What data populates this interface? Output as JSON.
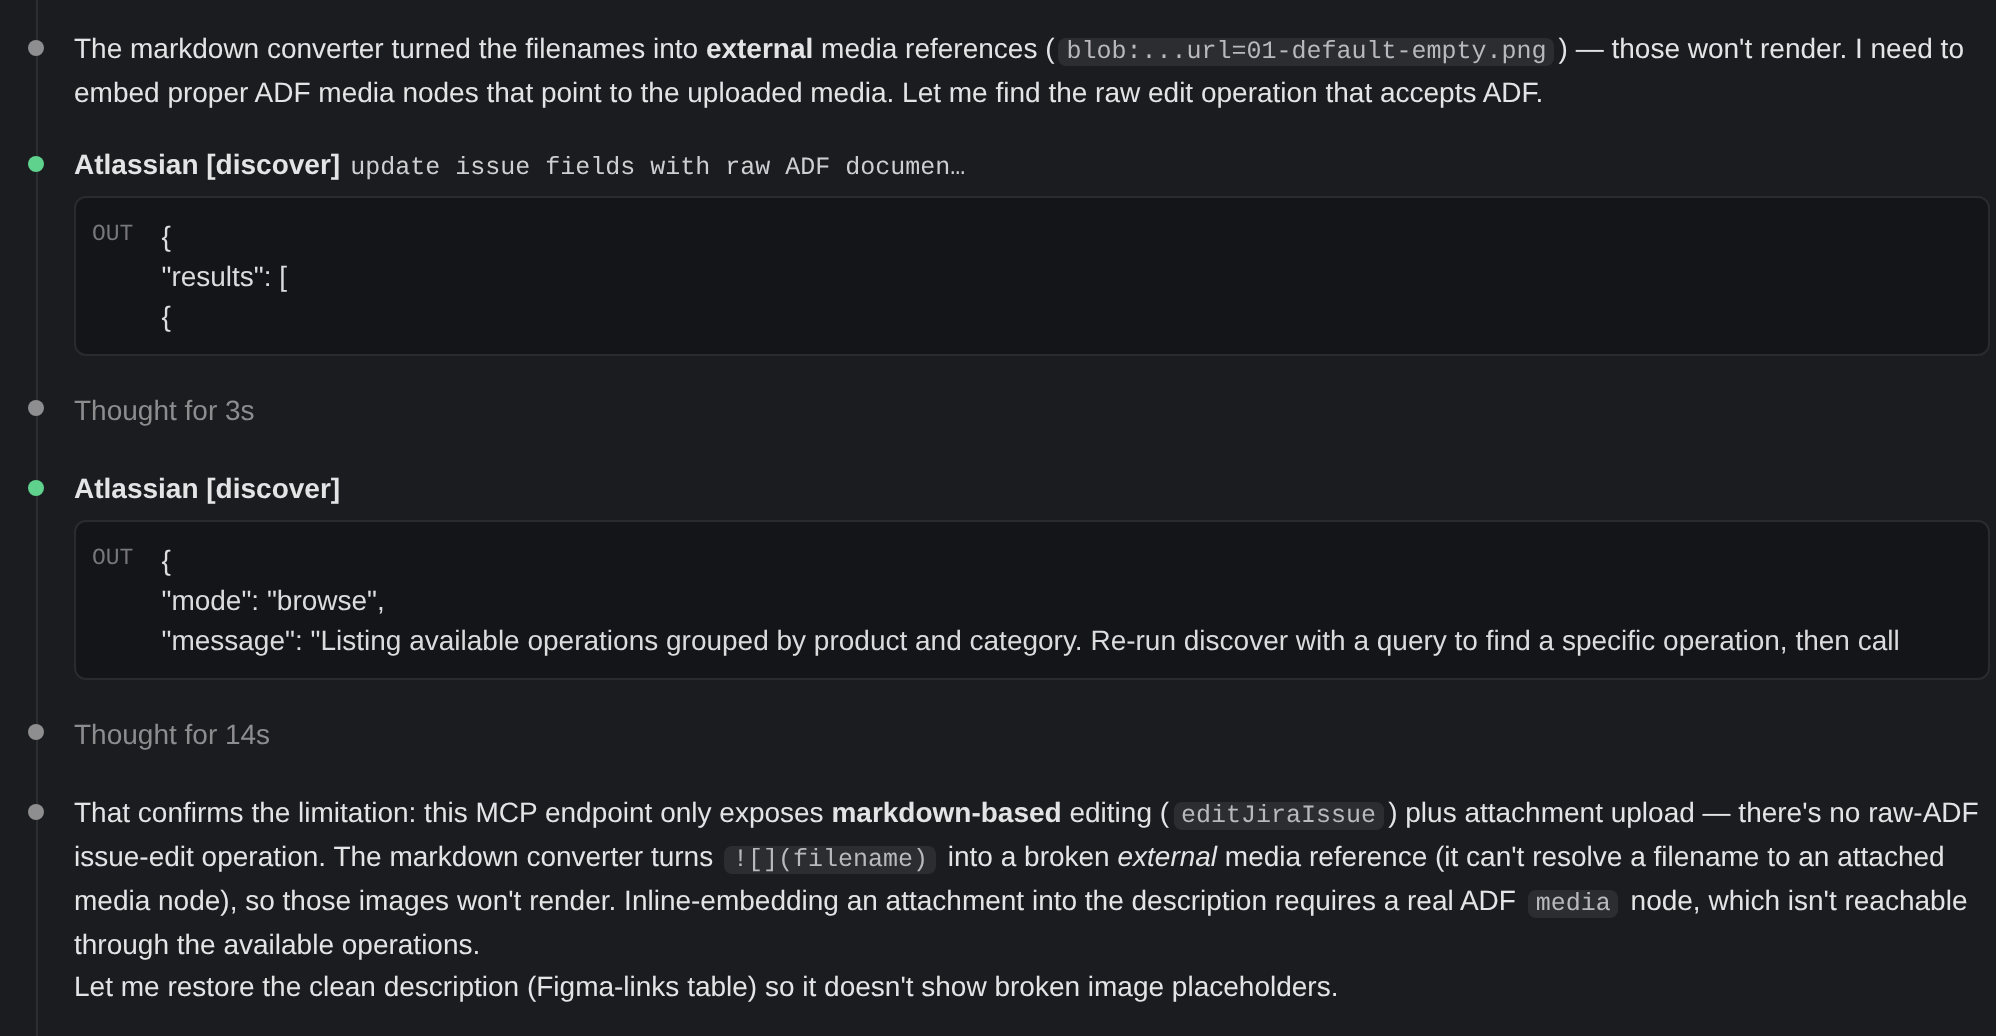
{
  "timeline": [
    {
      "kind": "message",
      "color": "#8e8e90",
      "paragraphs": [
        [
          {
            "kind": "text",
            "text": "The markdown converter turned the filenames into **external** media references ("
          },
          {
            "kind": "code",
            "text": "blob:...url=01-default-empty.png"
          },
          {
            "kind": "text",
            "text": ") — those won't render. I need to embed proper ADF media nodes that point to the uploaded media. Let me find the raw edit operation that accepts ADF."
          }
        ]
      ]
    },
    {
      "kind": "tool",
      "color": "#5fd38d",
      "title": "Atlassian [discover]",
      "query": "update issue fields with raw ADF documen…",
      "output": {
        "label": "OUT",
        "lines": [
          {
            "text": "{",
            "children": [
              {
                "text": "\"results\": ["
              },
              {
                "text": "{"
              }
            ]
          }
        ]
      }
    },
    {
      "kind": "thought",
      "color": "#8e8e90",
      "text": "Thought for 3s"
    },
    {
      "kind": "tool",
      "color": "#5fd38d",
      "title": "Atlassian [discover]",
      "output": {
        "label": "OUT",
        "lines": [
          {
            "text": "{",
            "children": [
              {
                "text": "\"mode\": \"browse\","
              },
              {
                "text": "\"message\": \"Listing available operations grouped by product and category. Re-run discover with a query to find a specific operation, then call"
              }
            ]
          }
        ]
      }
    },
    {
      "kind": "thought",
      "color": "#8e8e90",
      "text": "Thought for 14s"
    },
    {
      "kind": "message",
      "color": "#8e8e90",
      "paragraphs": [
        [
          {
            "kind": "text",
            "text": "That confirms the limitation: this MCP endpoint only exposes **markdown-based** editing ("
          },
          {
            "kind": "code",
            "text": "editJiraIssue"
          },
          {
            "kind": "text",
            "text": ") plus attachment upload — there's no raw-ADF issue-edit operation. The markdown converter turns "
          },
          {
            "kind": "code",
            "text": "![](filename)"
          },
          {
            "kind": "text",
            "text": " into a broken *external* media reference (it can't resolve a filename to an attached media node), so those images won't render. Inline-embedding an attachment into the description requires a real ADF "
          },
          {
            "kind": "code",
            "text": "media"
          },
          {
            "kind": "text",
            "text": " node, which isn't reachable through the available operations."
          }
        ],
        [
          {
            "kind": "text",
            "text": "Let me restore the clean description (Figma-links table) so it doesn't show broken image placeholders."
          }
        ]
      ]
    }
  ]
}
